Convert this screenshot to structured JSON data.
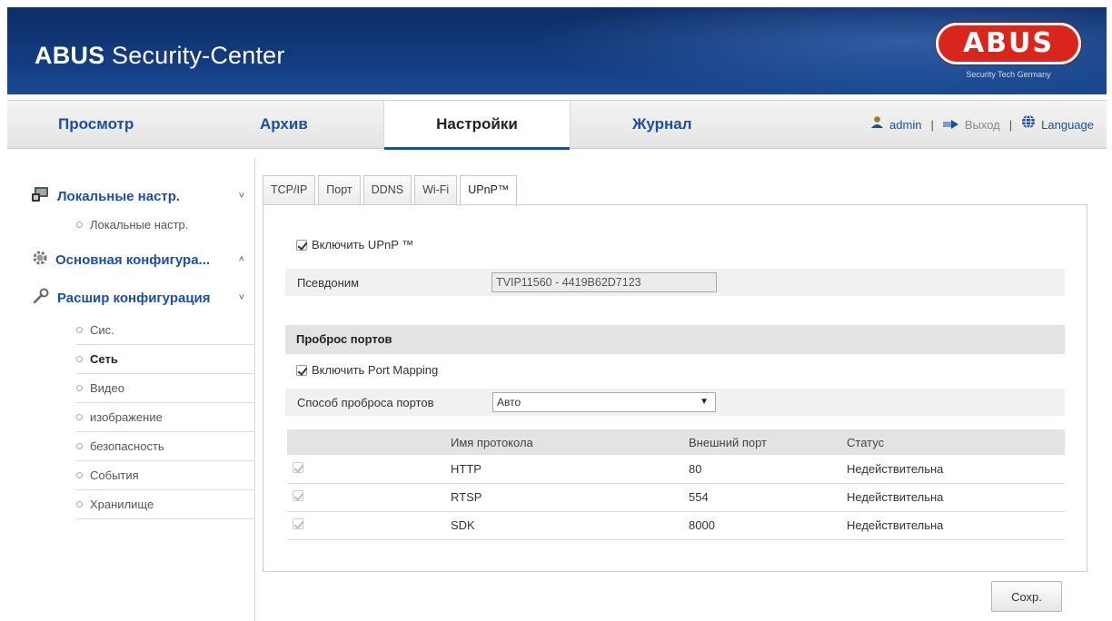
{
  "header": {
    "title_bold": "ABUS",
    "title_rest": " Security-Center",
    "logo_text": "ABUS",
    "logo_subtitle": "Security Tech Germany"
  },
  "nav": {
    "tabs": [
      {
        "label": "Просмотр"
      },
      {
        "label": "Архив"
      },
      {
        "label": "Настройки",
        "active": true
      },
      {
        "label": "Журнал"
      }
    ],
    "user": "admin",
    "logout": "Выход",
    "language": "Language",
    "separator": "|"
  },
  "sidebar": {
    "groups": [
      {
        "label": "Локальные настр.",
        "chevron": "˅",
        "icon": "monitor-icon"
      },
      {
        "label": "Основная конфигура...",
        "chevron": "˄",
        "icon": "gear-icon"
      },
      {
        "label": "Расшир конфигурация",
        "chevron": "˅",
        "icon": "wrench-icon"
      }
    ],
    "local_items": [
      "Локальные настр."
    ],
    "advanced_items": [
      "Сис.",
      "Сеть",
      "Видео",
      "изображение",
      "безопасность",
      "События",
      "Хранилище"
    ],
    "active_item": "Сеть"
  },
  "subtabs": [
    "TCP/IP",
    "Порт",
    "DDNS",
    "Wi-Fi",
    "UPnP™"
  ],
  "upnp": {
    "enable_label": "Включить UPnP ™",
    "enabled": true,
    "alias_label": "Псевдоним",
    "alias_value": "TVIP11560 - 4419B62D7123"
  },
  "port_mapping": {
    "section_title": "Проброс портов",
    "enable_label": "Включить Port Mapping",
    "enabled": true,
    "mode_label": "Способ проброса портов",
    "mode_value": "Авто",
    "select_arrow": "▼",
    "table": {
      "headers": [
        "",
        "Имя протокола",
        "Внешний порт",
        "Статус"
      ],
      "rows": [
        {
          "checked": true,
          "protocol": "HTTP",
          "port": "80",
          "status": "Недействительна"
        },
        {
          "checked": true,
          "protocol": "RTSP",
          "port": "554",
          "status": "Недействительна"
        },
        {
          "checked": true,
          "protocol": "SDK",
          "port": "8000",
          "status": "Недействительна"
        }
      ]
    }
  },
  "save_label": "Сохр.",
  "colors": {
    "header_blue": "#123a7c",
    "link_blue": "#1c4f9c",
    "logo_red": "#d9261c"
  }
}
